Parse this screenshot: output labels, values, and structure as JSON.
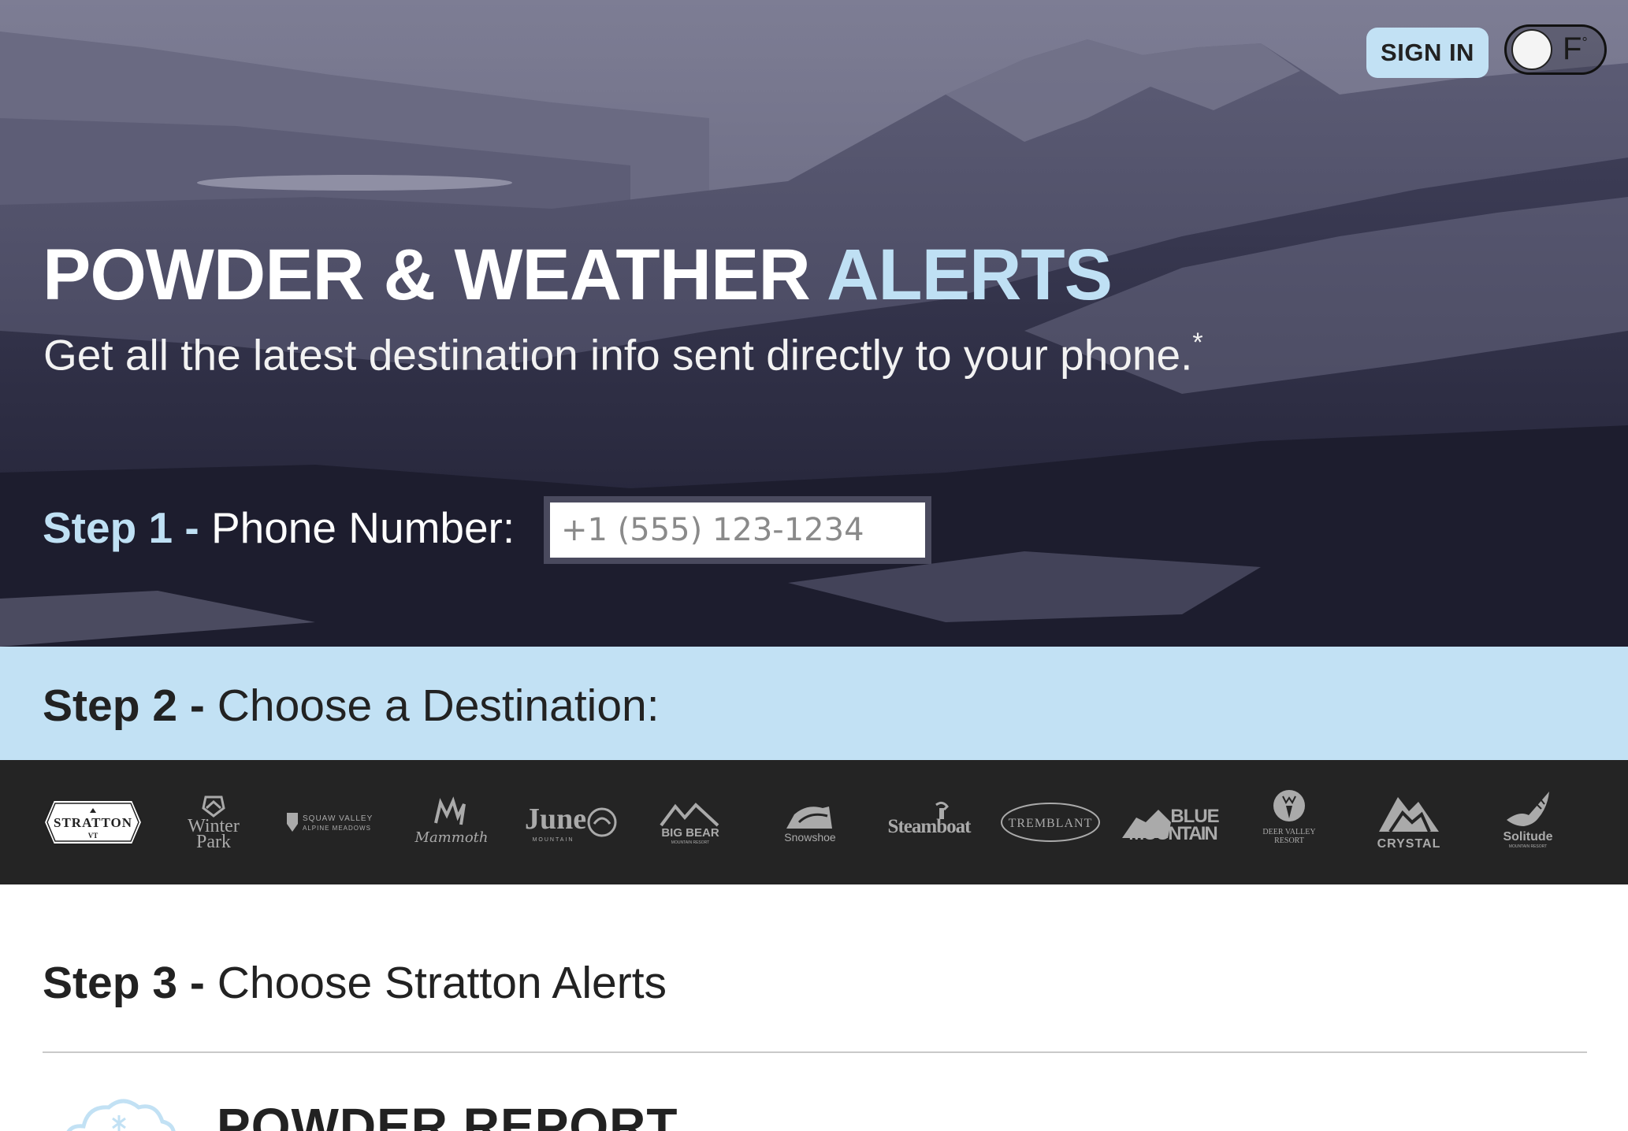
{
  "header": {
    "sign_in_label": "SIGN IN",
    "temp_unit": "F",
    "temp_degree": "°"
  },
  "hero": {
    "title_main": "POWDER & WEATHER",
    "title_accent": "ALERTS",
    "subtitle": "Get all the latest destination info sent directly to your phone.",
    "subtitle_mark": "*"
  },
  "step1": {
    "step_label": "Step 1 -",
    "field_label": "Phone Number:",
    "phone_placeholder": "+1 (555) 123-1234",
    "phone_value": ""
  },
  "step2": {
    "step_label": "Step 2 -",
    "text": "Choose a Destination:"
  },
  "destinations": [
    {
      "name": "STRATTON",
      "sub": "VT",
      "selected": true
    },
    {
      "name": "Winter",
      "sub": "Park"
    },
    {
      "name": "SQUAW VALLEY",
      "sub": "ALPINE MEADOWS"
    },
    {
      "name": "Mammoth",
      "sub": ""
    },
    {
      "name": "June",
      "sub": "MOUNTAIN"
    },
    {
      "name": "BIG BEAR",
      "sub": "MOUNTAIN RESORT"
    },
    {
      "name": "Snowshoe",
      "sub": ""
    },
    {
      "name": "Steamboat",
      "sub": ""
    },
    {
      "name": "TREMBLANT",
      "sub": ""
    },
    {
      "name": "BLUE",
      "sub": "MOUNTAIN"
    },
    {
      "name": "DEER VALLEY",
      "sub": "RESORT"
    },
    {
      "name": "CRYSTAL",
      "sub": ""
    },
    {
      "name": "Solitude",
      "sub": "MOUNTAIN RESORT"
    }
  ],
  "step3": {
    "step_label": "Step 3 -",
    "text": "Choose Stratton Alerts"
  },
  "alert_card": {
    "title": "POWDER REPORT",
    "icon": "snow-cloud-icon"
  },
  "colors": {
    "accent": "#bfe0f4",
    "band": "#c2e1f4",
    "logo_strip": "#242424"
  }
}
